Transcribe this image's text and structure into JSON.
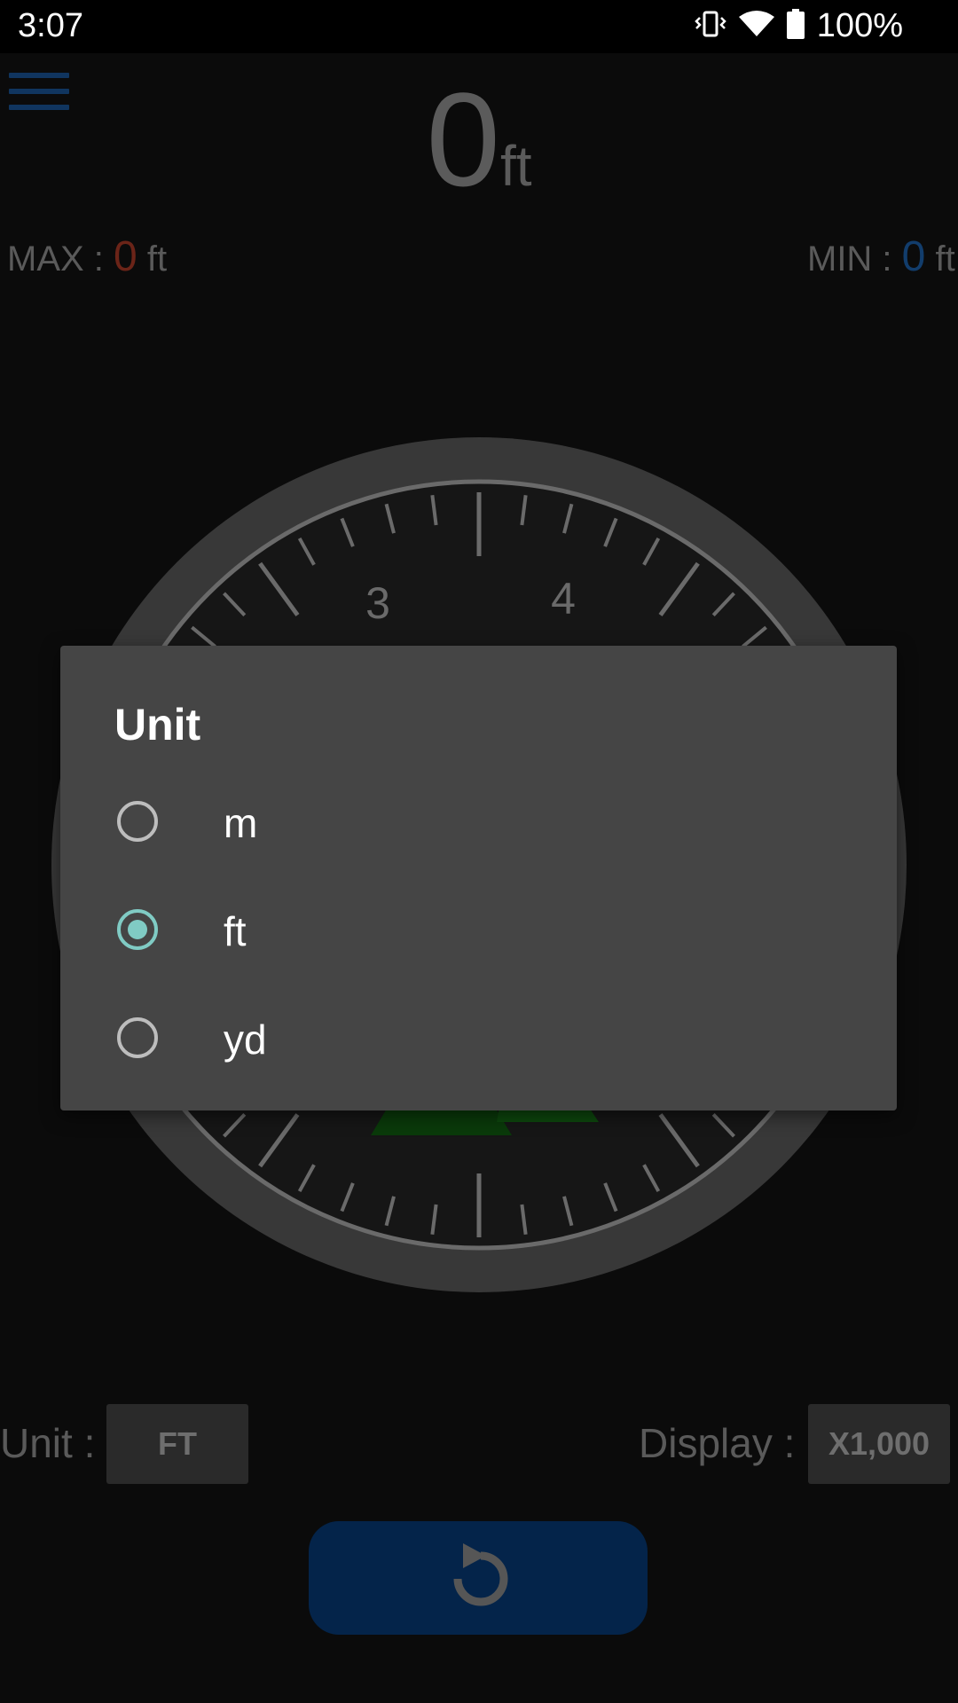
{
  "status_bar": {
    "time": "3:07",
    "battery": "100%",
    "icons": [
      "vibrate-icon",
      "wifi-icon",
      "battery-icon"
    ]
  },
  "header": {
    "menu_icon": "hamburger-menu-icon",
    "altitude_value": "0",
    "altitude_unit": "ft"
  },
  "stats": {
    "max_label": "MAX :",
    "max_value": "0",
    "max_unit": "ft",
    "min_label": "MIN :",
    "min_value": "0",
    "min_unit": "ft"
  },
  "gauge": {
    "tick_labels": [
      "3",
      "4"
    ]
  },
  "controls": {
    "unit_label": "Unit :",
    "unit_value": "FT",
    "display_label": "Display :",
    "display_value": "X1,000",
    "reset_icon": "reset-icon"
  },
  "dialog": {
    "title": "Unit",
    "options": [
      {
        "label": "m",
        "selected": false
      },
      {
        "label": "ft",
        "selected": true
      },
      {
        "label": "yd",
        "selected": false
      }
    ]
  },
  "colors": {
    "accent": "#80cbc4",
    "max_red": "#6b2418",
    "min_blue": "#123d6c",
    "button_blue": "#04244a"
  }
}
